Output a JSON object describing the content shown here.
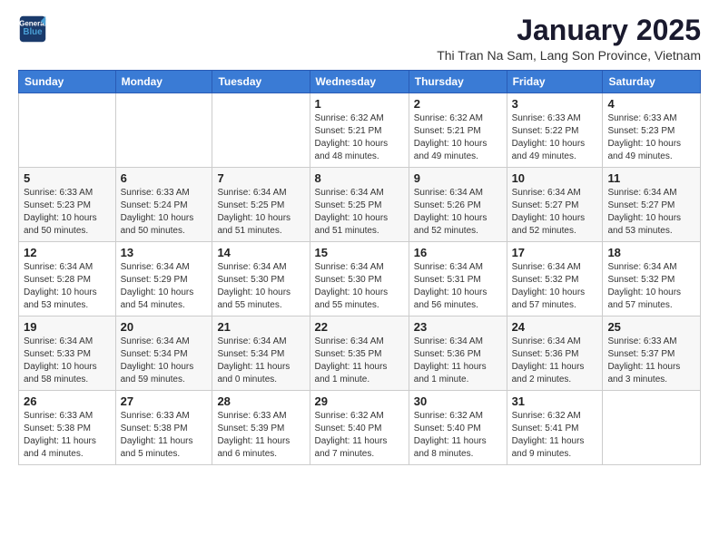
{
  "app": {
    "name_line1": "General",
    "name_line2": "Blue"
  },
  "header": {
    "title": "January 2025",
    "subtitle": "Thi Tran Na Sam, Lang Son Province, Vietnam"
  },
  "weekdays": [
    "Sunday",
    "Monday",
    "Tuesday",
    "Wednesday",
    "Thursday",
    "Friday",
    "Saturday"
  ],
  "weeks": [
    [
      {
        "day": "",
        "info": ""
      },
      {
        "day": "",
        "info": ""
      },
      {
        "day": "",
        "info": ""
      },
      {
        "day": "1",
        "info": "Sunrise: 6:32 AM\nSunset: 5:21 PM\nDaylight: 10 hours\nand 48 minutes."
      },
      {
        "day": "2",
        "info": "Sunrise: 6:32 AM\nSunset: 5:21 PM\nDaylight: 10 hours\nand 49 minutes."
      },
      {
        "day": "3",
        "info": "Sunrise: 6:33 AM\nSunset: 5:22 PM\nDaylight: 10 hours\nand 49 minutes."
      },
      {
        "day": "4",
        "info": "Sunrise: 6:33 AM\nSunset: 5:23 PM\nDaylight: 10 hours\nand 49 minutes."
      }
    ],
    [
      {
        "day": "5",
        "info": "Sunrise: 6:33 AM\nSunset: 5:23 PM\nDaylight: 10 hours\nand 50 minutes."
      },
      {
        "day": "6",
        "info": "Sunrise: 6:33 AM\nSunset: 5:24 PM\nDaylight: 10 hours\nand 50 minutes."
      },
      {
        "day": "7",
        "info": "Sunrise: 6:34 AM\nSunset: 5:25 PM\nDaylight: 10 hours\nand 51 minutes."
      },
      {
        "day": "8",
        "info": "Sunrise: 6:34 AM\nSunset: 5:25 PM\nDaylight: 10 hours\nand 51 minutes."
      },
      {
        "day": "9",
        "info": "Sunrise: 6:34 AM\nSunset: 5:26 PM\nDaylight: 10 hours\nand 52 minutes."
      },
      {
        "day": "10",
        "info": "Sunrise: 6:34 AM\nSunset: 5:27 PM\nDaylight: 10 hours\nand 52 minutes."
      },
      {
        "day": "11",
        "info": "Sunrise: 6:34 AM\nSunset: 5:27 PM\nDaylight: 10 hours\nand 53 minutes."
      }
    ],
    [
      {
        "day": "12",
        "info": "Sunrise: 6:34 AM\nSunset: 5:28 PM\nDaylight: 10 hours\nand 53 minutes."
      },
      {
        "day": "13",
        "info": "Sunrise: 6:34 AM\nSunset: 5:29 PM\nDaylight: 10 hours\nand 54 minutes."
      },
      {
        "day": "14",
        "info": "Sunrise: 6:34 AM\nSunset: 5:30 PM\nDaylight: 10 hours\nand 55 minutes."
      },
      {
        "day": "15",
        "info": "Sunrise: 6:34 AM\nSunset: 5:30 PM\nDaylight: 10 hours\nand 55 minutes."
      },
      {
        "day": "16",
        "info": "Sunrise: 6:34 AM\nSunset: 5:31 PM\nDaylight: 10 hours\nand 56 minutes."
      },
      {
        "day": "17",
        "info": "Sunrise: 6:34 AM\nSunset: 5:32 PM\nDaylight: 10 hours\nand 57 minutes."
      },
      {
        "day": "18",
        "info": "Sunrise: 6:34 AM\nSunset: 5:32 PM\nDaylight: 10 hours\nand 57 minutes."
      }
    ],
    [
      {
        "day": "19",
        "info": "Sunrise: 6:34 AM\nSunset: 5:33 PM\nDaylight: 10 hours\nand 58 minutes."
      },
      {
        "day": "20",
        "info": "Sunrise: 6:34 AM\nSunset: 5:34 PM\nDaylight: 10 hours\nand 59 minutes."
      },
      {
        "day": "21",
        "info": "Sunrise: 6:34 AM\nSunset: 5:34 PM\nDaylight: 11 hours\nand 0 minutes."
      },
      {
        "day": "22",
        "info": "Sunrise: 6:34 AM\nSunset: 5:35 PM\nDaylight: 11 hours\nand 1 minute."
      },
      {
        "day": "23",
        "info": "Sunrise: 6:34 AM\nSunset: 5:36 PM\nDaylight: 11 hours\nand 1 minute."
      },
      {
        "day": "24",
        "info": "Sunrise: 6:34 AM\nSunset: 5:36 PM\nDaylight: 11 hours\nand 2 minutes."
      },
      {
        "day": "25",
        "info": "Sunrise: 6:33 AM\nSunset: 5:37 PM\nDaylight: 11 hours\nand 3 minutes."
      }
    ],
    [
      {
        "day": "26",
        "info": "Sunrise: 6:33 AM\nSunset: 5:38 PM\nDaylight: 11 hours\nand 4 minutes."
      },
      {
        "day": "27",
        "info": "Sunrise: 6:33 AM\nSunset: 5:38 PM\nDaylight: 11 hours\nand 5 minutes."
      },
      {
        "day": "28",
        "info": "Sunrise: 6:33 AM\nSunset: 5:39 PM\nDaylight: 11 hours\nand 6 minutes."
      },
      {
        "day": "29",
        "info": "Sunrise: 6:32 AM\nSunset: 5:40 PM\nDaylight: 11 hours\nand 7 minutes."
      },
      {
        "day": "30",
        "info": "Sunrise: 6:32 AM\nSunset: 5:40 PM\nDaylight: 11 hours\nand 8 minutes."
      },
      {
        "day": "31",
        "info": "Sunrise: 6:32 AM\nSunset: 5:41 PM\nDaylight: 11 hours\nand 9 minutes."
      },
      {
        "day": "",
        "info": ""
      }
    ]
  ]
}
